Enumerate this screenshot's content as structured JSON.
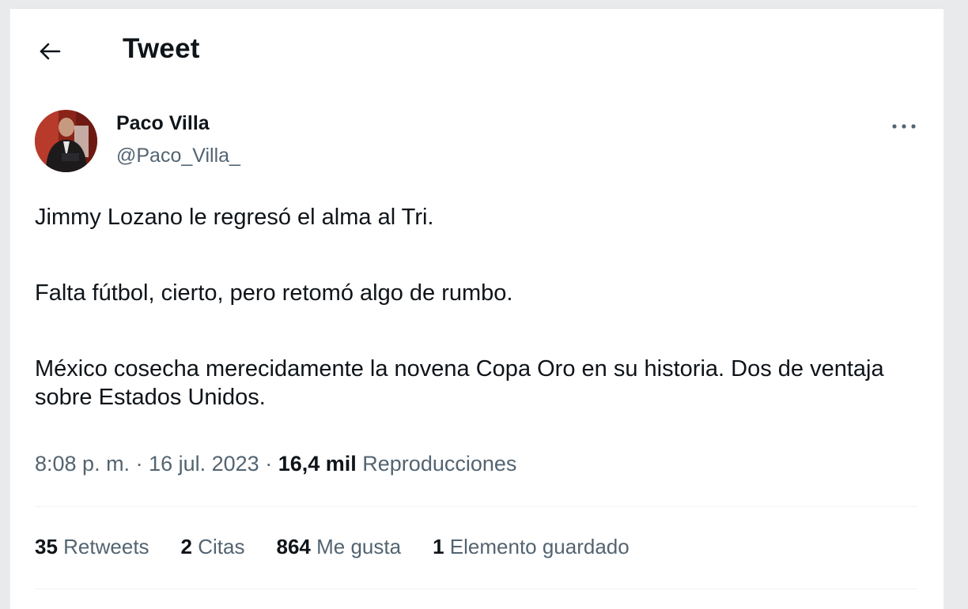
{
  "header": {
    "title": "Tweet",
    "back_icon": "arrow-left-icon"
  },
  "author": {
    "name": "Paco Villa",
    "handle": "@Paco_Villa_"
  },
  "tweet": {
    "paragraphs": [
      "Jimmy Lozano le regresó el alma al Tri.",
      "Falta fútbol, cierto, pero retomó algo de rumbo.",
      "México cosecha merecidamente la novena Copa Oro en su historia. Dos de ventaja sobre Estados Unidos."
    ]
  },
  "meta": {
    "time": "8:08 p. m.",
    "sep1": " · ",
    "date": "16 jul. 2023",
    "sep2": " · ",
    "views_count": "16,4 mil",
    "views_label": "Reproducciones"
  },
  "stats": {
    "retweets_count": "35",
    "retweets_label": "Retweets",
    "quotes_count": "2",
    "quotes_label": "Citas",
    "likes_count": "864",
    "likes_label": "Me gusta",
    "bookmarks_count": "1",
    "bookmarks_label": "Elemento guardado"
  },
  "colors": {
    "text_primary": "#0f1419",
    "text_secondary": "#536471",
    "divider": "#eff3f4"
  }
}
